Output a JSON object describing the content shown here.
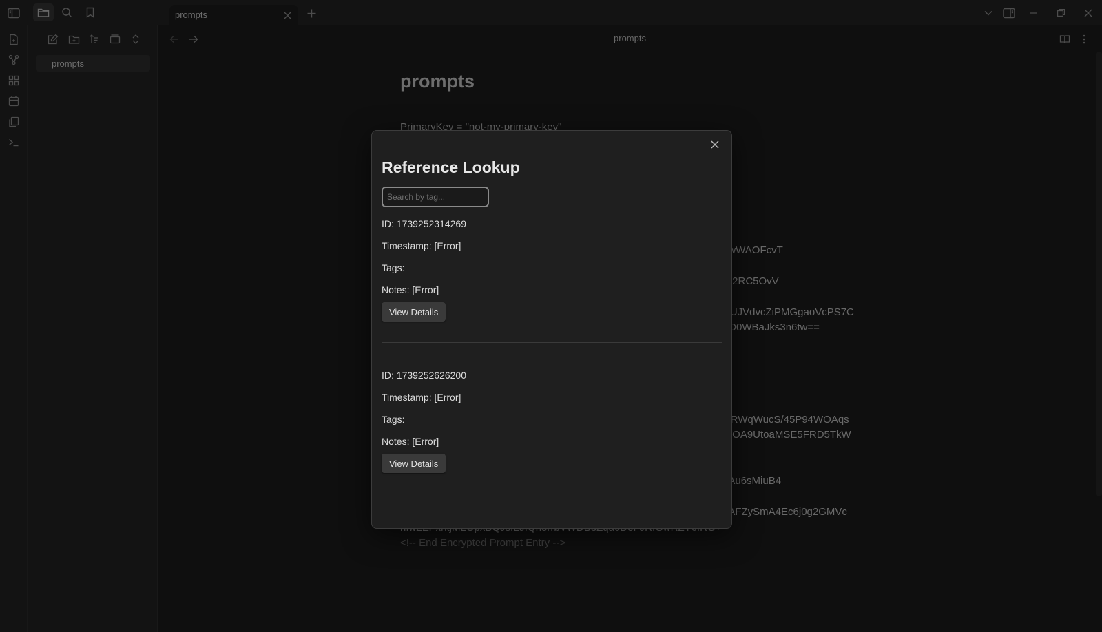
{
  "titlebar": {
    "tab_title": "prompts"
  },
  "sidebar": {
    "files": [
      {
        "name": "prompts"
      }
    ]
  },
  "editor": {
    "view_title": "prompts",
    "doc_title": "prompts",
    "line_primary_key": "PrimaryKey = \"not-my-primary-key\"",
    "visible_right_fragments": [
      "nwWAOFcvT",
      "jN2RC5OvV",
      "CUJVdvcZiPMGgaoVcPS7C",
      "aO0WBaJks3n6tw==",
      "0lRWqWucS/45P94WOAqs",
      "WOA9UtoaMSE5FRD5TkW",
      "gAu6sMiuB4",
      "uAFZySmA4Ec6j0g2GMVc"
    ],
    "line_cipher_tail": "nIwZZPxhtjMLOpxBQJsIL9fQh5rrbVWDB3Zqa6DeFJRIGwRZY6fRG+",
    "line_end_comment": "<!-- End Encrypted Prompt Entry -->"
  },
  "modal": {
    "title": "Reference Lookup",
    "search_placeholder": "Search by tag...",
    "entries": [
      {
        "id": "ID: 1739252314269",
        "timestamp": "Timestamp: [Error]",
        "tags": "Tags:",
        "notes": "Notes: [Error]",
        "button": "View Details"
      },
      {
        "id": "ID: 1739252626200",
        "timestamp": "Timestamp: [Error]",
        "tags": "Tags:",
        "notes": "Notes: [Error]",
        "button": "View Details"
      }
    ]
  },
  "icons": {
    "ribbon": [
      "file-plus-icon",
      "graph-icon",
      "grid-icon",
      "calendar-icon",
      "copy-icon",
      "terminal-icon"
    ],
    "titlebar_left": [
      "sidebar-toggle-icon",
      "folder-icon",
      "search-icon",
      "bookmark-icon"
    ],
    "sidebar_toolbar": [
      "new-note-icon",
      "new-folder-icon",
      "sort-icon",
      "collapse-icon",
      "expand-icon"
    ]
  }
}
